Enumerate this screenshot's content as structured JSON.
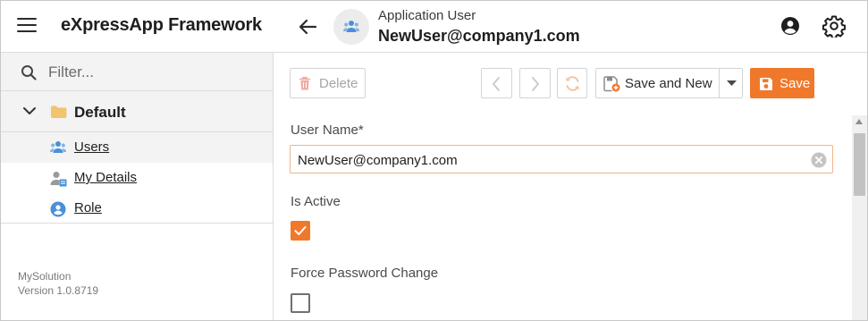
{
  "header": {
    "app_title": "eXpressApp Framework",
    "view_caption": "Application User",
    "view_object": "NewUser@company1.com"
  },
  "sidebar": {
    "filter_placeholder": "Filter...",
    "group_label": "Default",
    "items": [
      {
        "label": "Users",
        "icon": "users-icon",
        "selected": true
      },
      {
        "label": "My Details",
        "icon": "user-details-icon",
        "selected": false
      },
      {
        "label": "Role",
        "icon": "role-icon",
        "selected": false
      }
    ],
    "about_name": "MySolution",
    "about_version": "Version 1.0.8719"
  },
  "toolbar": {
    "delete_label": "Delete",
    "save_and_new_label": "Save and New",
    "save_label": "Save"
  },
  "form": {
    "user_name_label": "User Name*",
    "user_name_value": "NewUser@company1.com",
    "is_active_label": "Is Active",
    "is_active_checked": true,
    "force_password_label": "Force Password Change",
    "force_password_checked": false
  },
  "colors": {
    "accent": "#f0782b",
    "icon_blue": "#4a90d9"
  }
}
